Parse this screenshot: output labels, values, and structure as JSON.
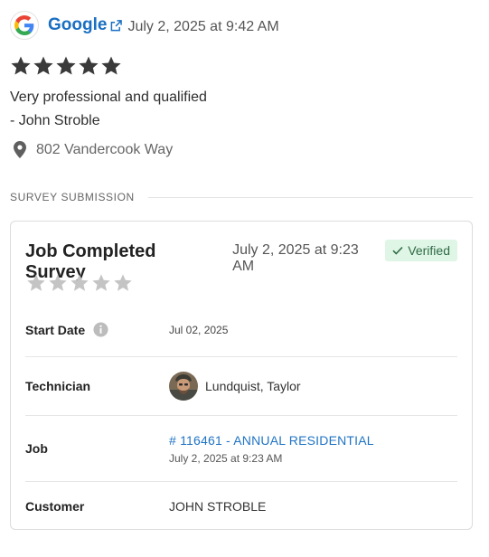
{
  "review": {
    "source": "Google",
    "date": "July 2, 2025 at 9:42 AM",
    "rating": 5,
    "text": "Very professional and qualified",
    "author": "- John Stroble",
    "location": "802 Vandercook Way"
  },
  "section_label": "SURVEY SUBMISSION",
  "survey": {
    "title": "Job Completed Survey",
    "date": "July 2, 2025 at 9:23 AM",
    "badge": "Verified",
    "rating": 0,
    "rows": {
      "start_date": {
        "label": "Start Date",
        "value": "Jul 02, 2025"
      },
      "technician": {
        "label": "Technician",
        "value": "Lundquist, Taylor"
      },
      "job": {
        "label": "Job",
        "link": "# 116461 - ANNUAL RESIDENTIAL",
        "date": "July 2, 2025 at 9:23 AM"
      },
      "customer": {
        "label": "Customer",
        "value": "JOHN STROBLE"
      }
    }
  },
  "colors": {
    "link": "#1a6fc2",
    "star_filled": "#3a3a3a",
    "star_empty": "#c4c4c4",
    "badge_bg": "#dff5e6",
    "badge_text": "#2f6b45"
  },
  "icons": [
    "google-logo-icon",
    "external-link-icon",
    "star-icon",
    "map-pin-icon",
    "check-icon",
    "info-icon"
  ]
}
